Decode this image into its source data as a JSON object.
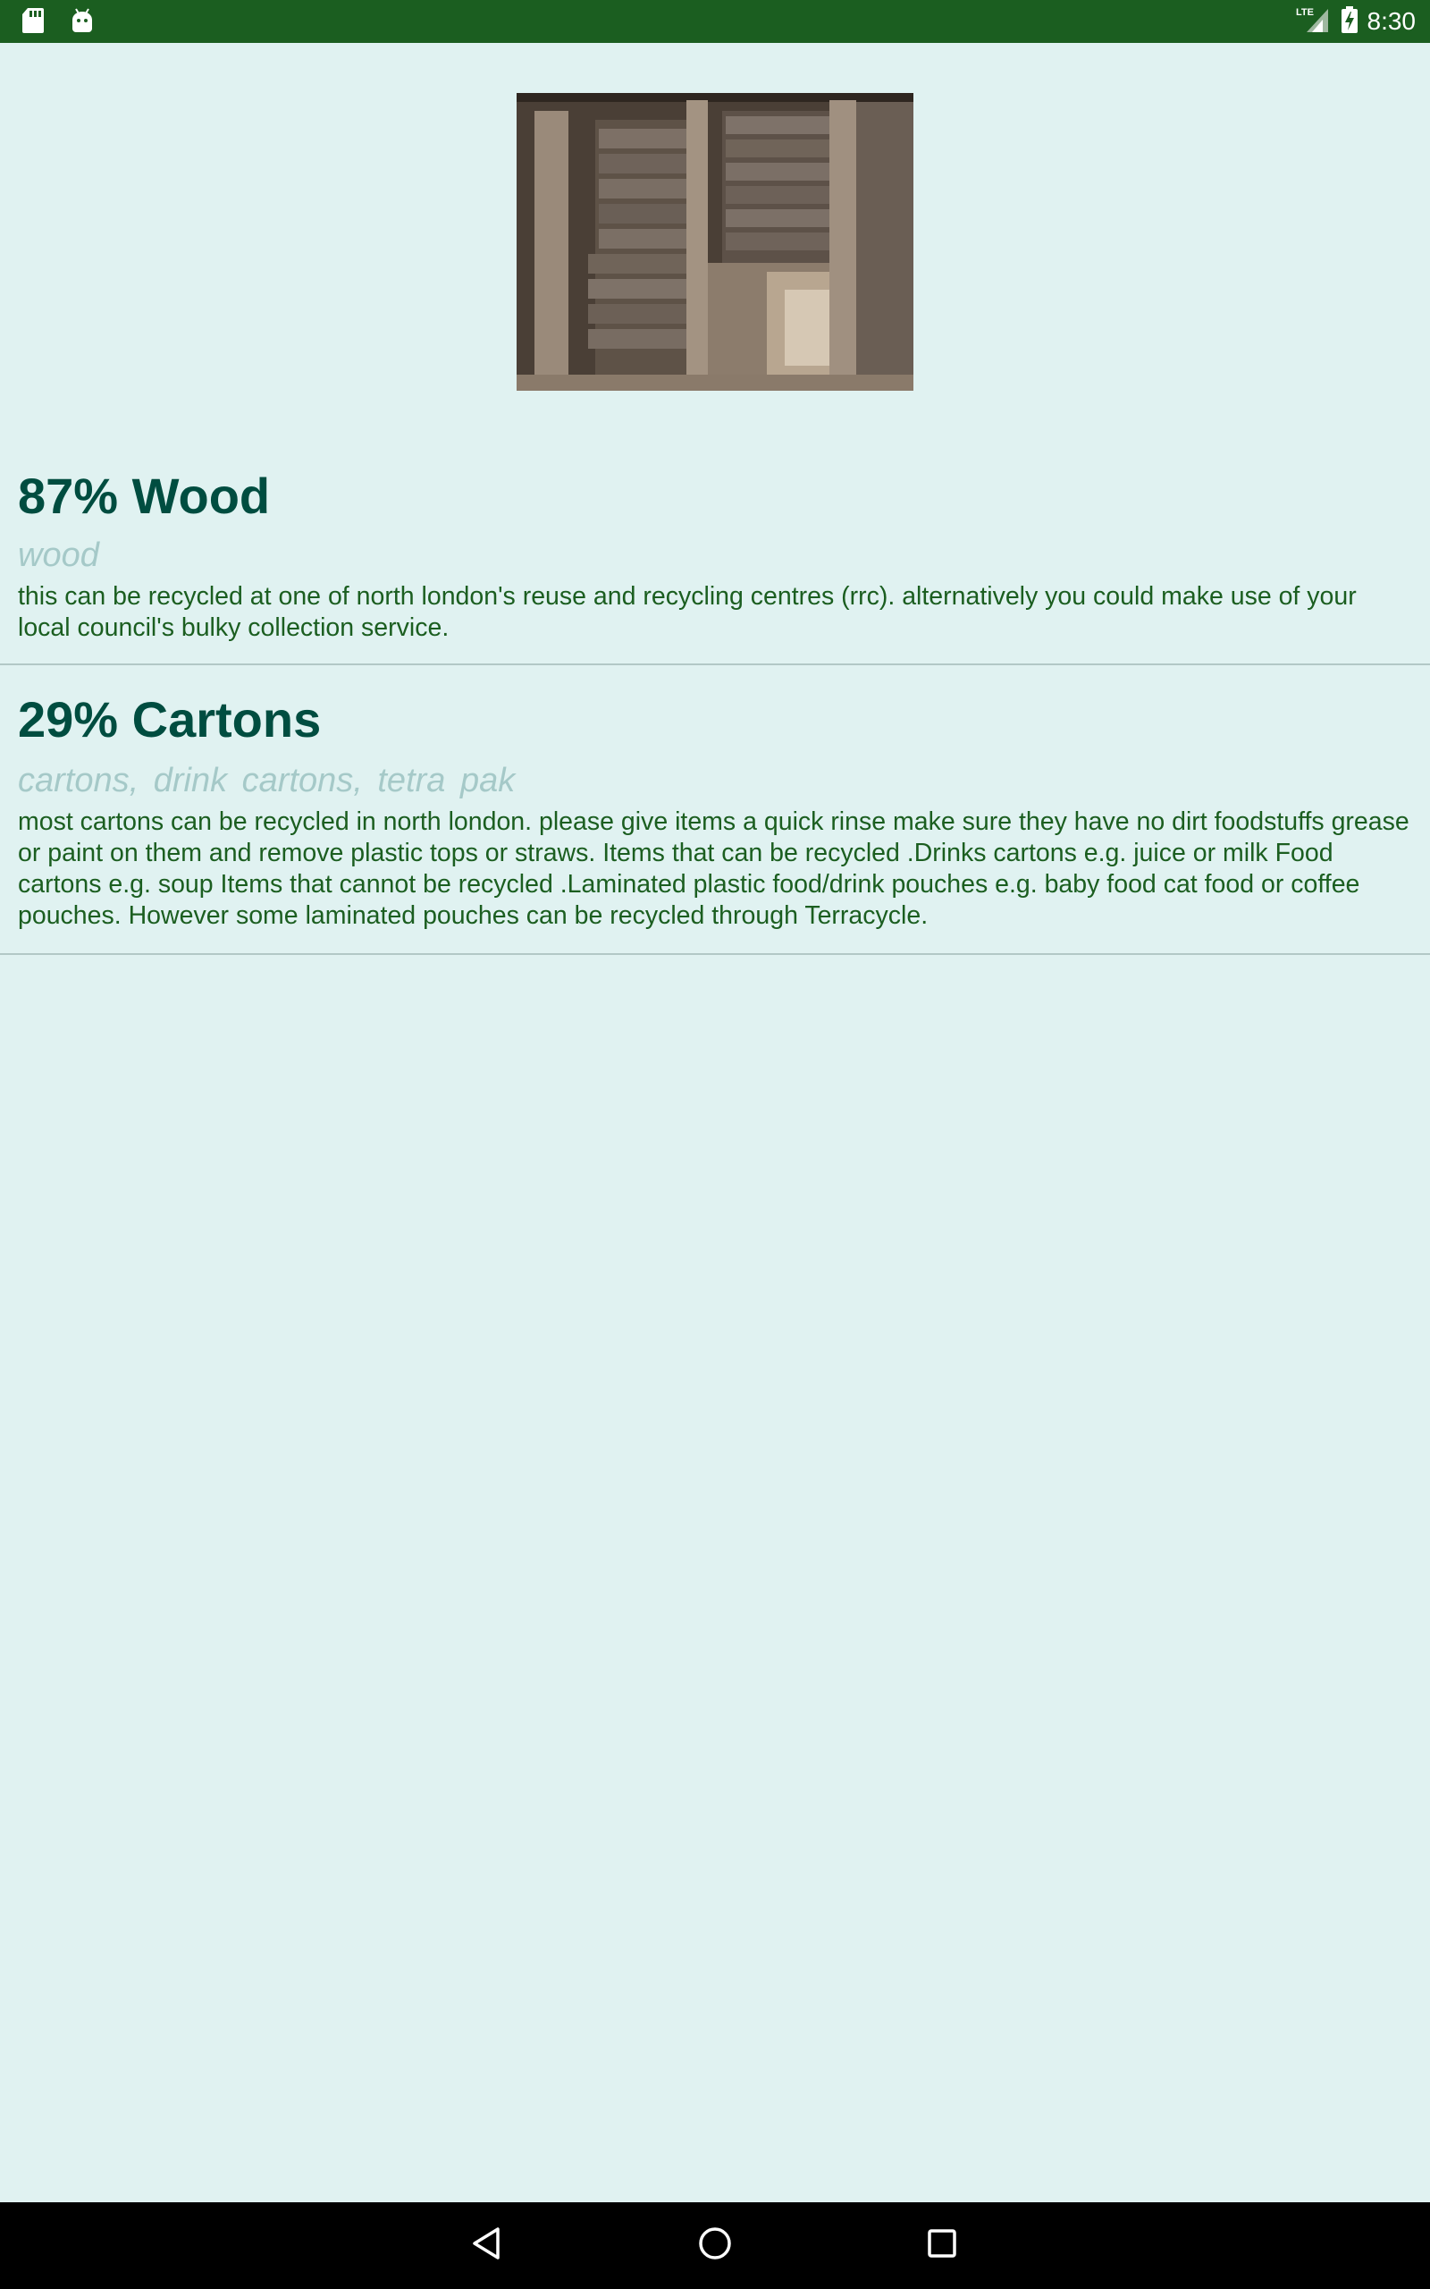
{
  "status_bar": {
    "time": "8:30",
    "network": "LTE",
    "icons": [
      "sd-card-icon",
      "android-debug-icon",
      "signal-icon",
      "battery-charging-icon"
    ]
  },
  "hero_image": {
    "alt": "wood"
  },
  "results": [
    {
      "title": "87% Wood",
      "tags": "wood",
      "description": "this can be recycled at one of north london's reuse and recycling centres (rrc). alternatively you could make use of your local council's bulky collection service."
    },
    {
      "title": "29% Cartons",
      "tags": "cartons,  drink cartons,  tetra pak",
      "description": "most cartons can be recycled in north london. please give items a quick rinse make sure they have no dirt foodstuffs grease or paint on them and remove plastic tops or straws. Items that can be recycled .Drinks cartons e.g. juice or milk Food cartons e.g. soup Items that cannot be recycled .Laminated plastic food/drink pouches e.g. baby food cat food or coffee pouches. However some laminated pouches can be recycled through Terracycle."
    }
  ],
  "nav_bar": {
    "buttons": [
      "back-icon",
      "home-icon",
      "recents-icon"
    ]
  },
  "colors": {
    "status_bar": "#1b5e20",
    "background": "#e0f2f1",
    "title": "#004d40",
    "tags": "#a5c9c8",
    "description": "#1b5e20",
    "nav_bar": "#000000"
  }
}
